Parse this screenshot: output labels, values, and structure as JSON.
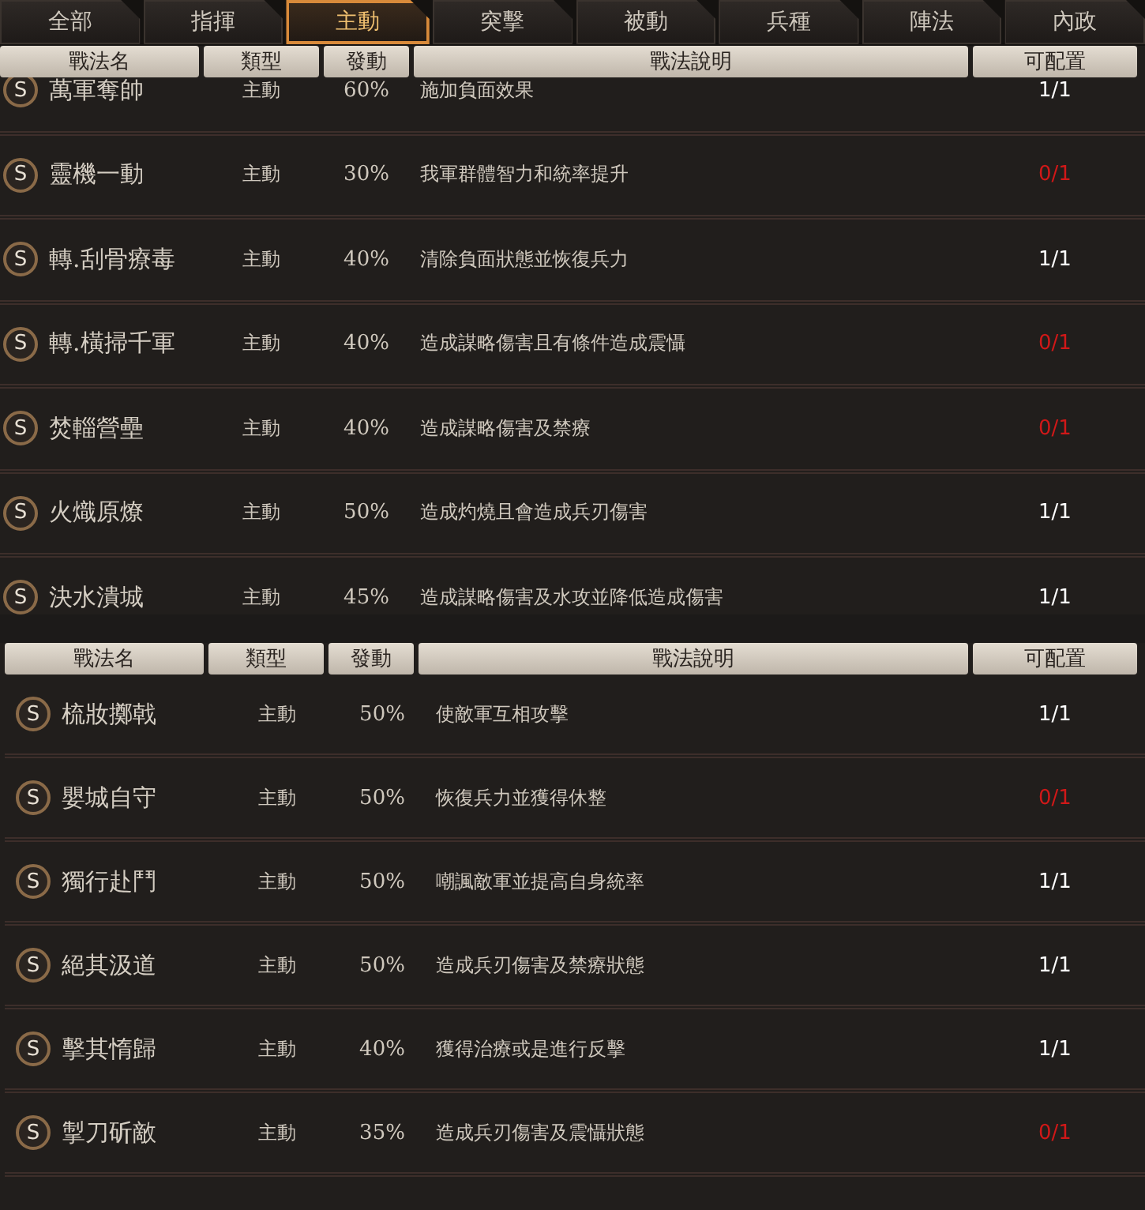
{
  "tabs": [
    {
      "label": "全部",
      "selected": false
    },
    {
      "label": "指揮",
      "selected": false
    },
    {
      "label": "主動",
      "selected": true
    },
    {
      "label": "突擊",
      "selected": false
    },
    {
      "label": "被動",
      "selected": false
    },
    {
      "label": "兵種",
      "selected": false
    },
    {
      "label": "陣法",
      "selected": false
    },
    {
      "label": "內政",
      "selected": false
    }
  ],
  "tables": [
    {
      "columns": [
        "戰法名",
        "類型",
        "發動",
        "戰法說明",
        "可配置"
      ],
      "rows": [
        {
          "grade": "S",
          "name": "萬軍奪帥",
          "type": "主動",
          "chance": "60%",
          "description": "施加負面效果",
          "capacity": "1/1",
          "available": true
        },
        {
          "grade": "S",
          "name": "靈機一動",
          "type": "主動",
          "chance": "30%",
          "description": "我軍群體智力和統率提升",
          "capacity": "0/1",
          "available": false
        },
        {
          "grade": "S",
          "name": "轉.刮骨療毒",
          "type": "主動",
          "chance": "40%",
          "description": "清除負面狀態並恢復兵力",
          "capacity": "1/1",
          "available": true
        },
        {
          "grade": "S",
          "name": "轉.橫掃千軍",
          "type": "主動",
          "chance": "40%",
          "description": "造成謀略傷害且有條件造成震懾",
          "capacity": "0/1",
          "available": false
        },
        {
          "grade": "S",
          "name": "焚輜營壘",
          "type": "主動",
          "chance": "40%",
          "description": "造成謀略傷害及禁療",
          "capacity": "0/1",
          "available": false
        },
        {
          "grade": "S",
          "name": "火熾原燎",
          "type": "主動",
          "chance": "50%",
          "description": "造成灼燒且會造成兵刃傷害",
          "capacity": "1/1",
          "available": true
        },
        {
          "grade": "S",
          "name": "決水潰城",
          "type": "主動",
          "chance": "45%",
          "description": "造成謀略傷害及水攻並降低造成傷害",
          "capacity": "1/1",
          "available": true
        }
      ]
    },
    {
      "columns": [
        "戰法名",
        "類型",
        "發動",
        "戰法說明",
        "可配置"
      ],
      "rows": [
        {
          "grade": "S",
          "name": "梳妝擲戟",
          "type": "主動",
          "chance": "50%",
          "description": "使敵軍互相攻擊",
          "capacity": "1/1",
          "available": true
        },
        {
          "grade": "S",
          "name": "嬰城自守",
          "type": "主動",
          "chance": "50%",
          "description": "恢復兵力並獲得休整",
          "capacity": "0/1",
          "available": false
        },
        {
          "grade": "S",
          "name": "獨行赴鬥",
          "type": "主動",
          "chance": "50%",
          "description": "嘲諷敵軍並提高自身統率",
          "capacity": "1/1",
          "available": true
        },
        {
          "grade": "S",
          "name": "絕其汲道",
          "type": "主動",
          "chance": "50%",
          "description": "造成兵刃傷害及禁療狀態",
          "capacity": "1/1",
          "available": true
        },
        {
          "grade": "S",
          "name": "擊其惰歸",
          "type": "主動",
          "chance": "40%",
          "description": "獲得治療或是進行反擊",
          "capacity": "1/1",
          "available": true
        },
        {
          "grade": "S",
          "name": "掣刀斫敵",
          "type": "主動",
          "chance": "35%",
          "description": "造成兵刃傷害及震懾狀態",
          "capacity": "0/1",
          "available": false
        }
      ]
    }
  ]
}
